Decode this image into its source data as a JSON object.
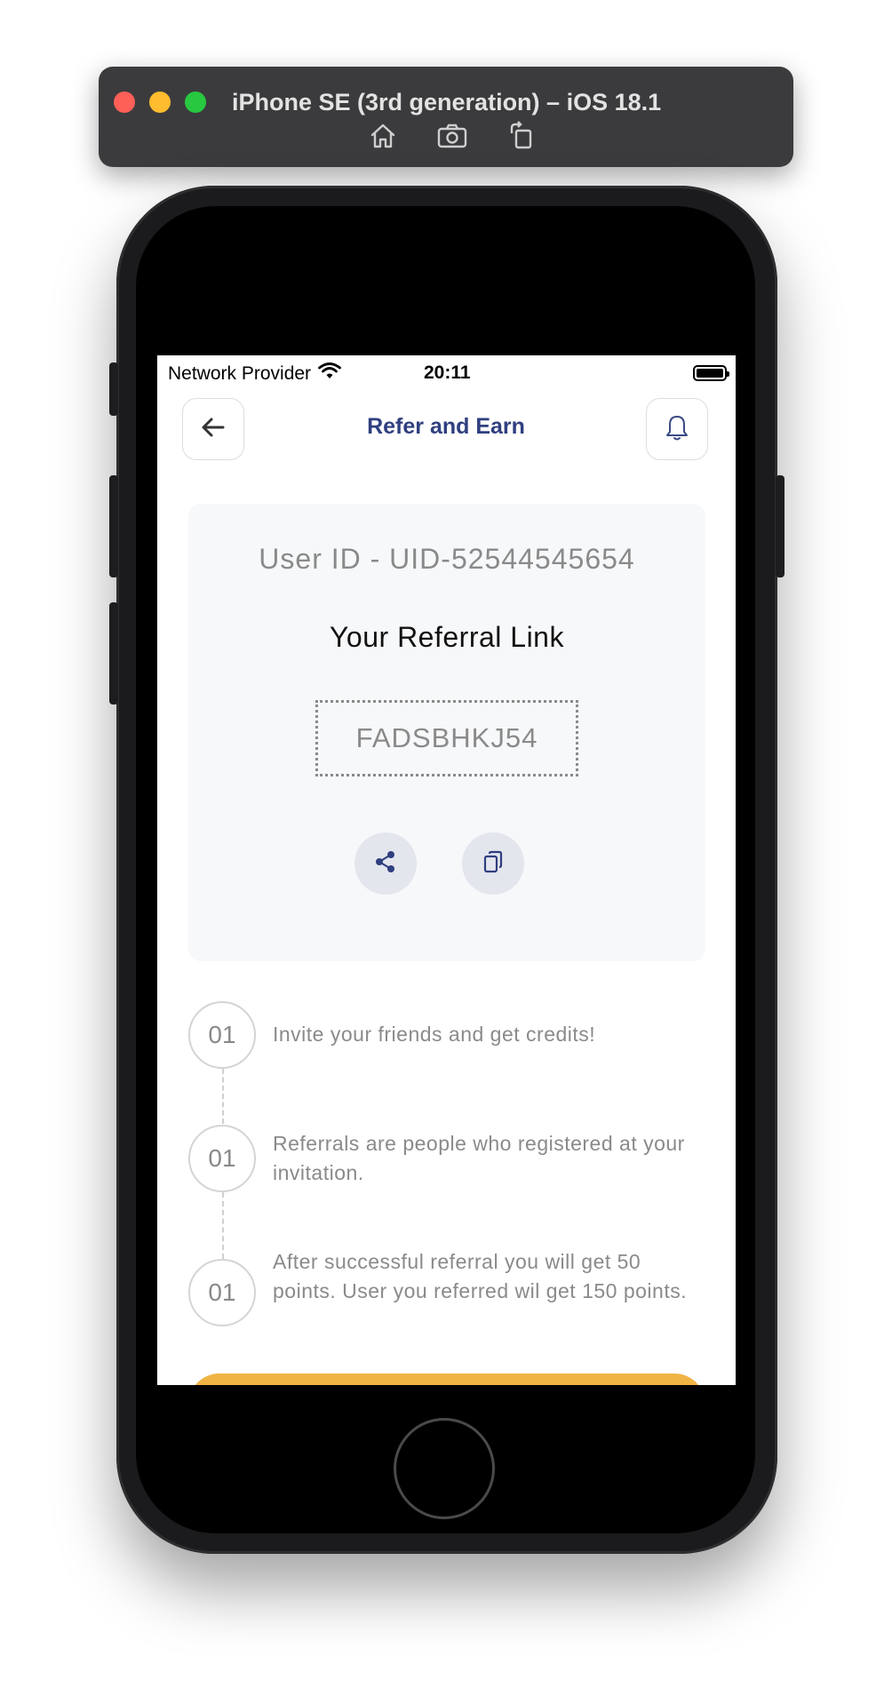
{
  "simulator": {
    "title": "iPhone SE (3rd generation) – iOS 18.1",
    "tools": [
      "home-icon",
      "screenshot-icon",
      "rotate-icon"
    ]
  },
  "status_bar": {
    "carrier": "Network Provider",
    "time": "20:11",
    "battery_level": 1.0
  },
  "header": {
    "title": "Refer and Earn",
    "back_icon": "arrow-left-icon",
    "notification_icon": "bell-icon"
  },
  "referral_card": {
    "user_id": "User ID - UID-52544545654",
    "link_label": "Your Referral Link",
    "code": "FADSBHKJ54",
    "actions": [
      "share-icon",
      "copy-icon"
    ]
  },
  "steps": [
    {
      "number": "01",
      "text": "Invite your friends and get credits!"
    },
    {
      "number": "01",
      "text": "Referrals are people who registered at your invitation."
    },
    {
      "number": "01",
      "text": "After successful referral you will get 50 points. User you referred wil get 150 points."
    }
  ],
  "colors": {
    "title": "#2f3f7f",
    "accent": "#f0b445",
    "card_bg": "#f7f8fa",
    "muted_text": "#8a8a8a"
  }
}
